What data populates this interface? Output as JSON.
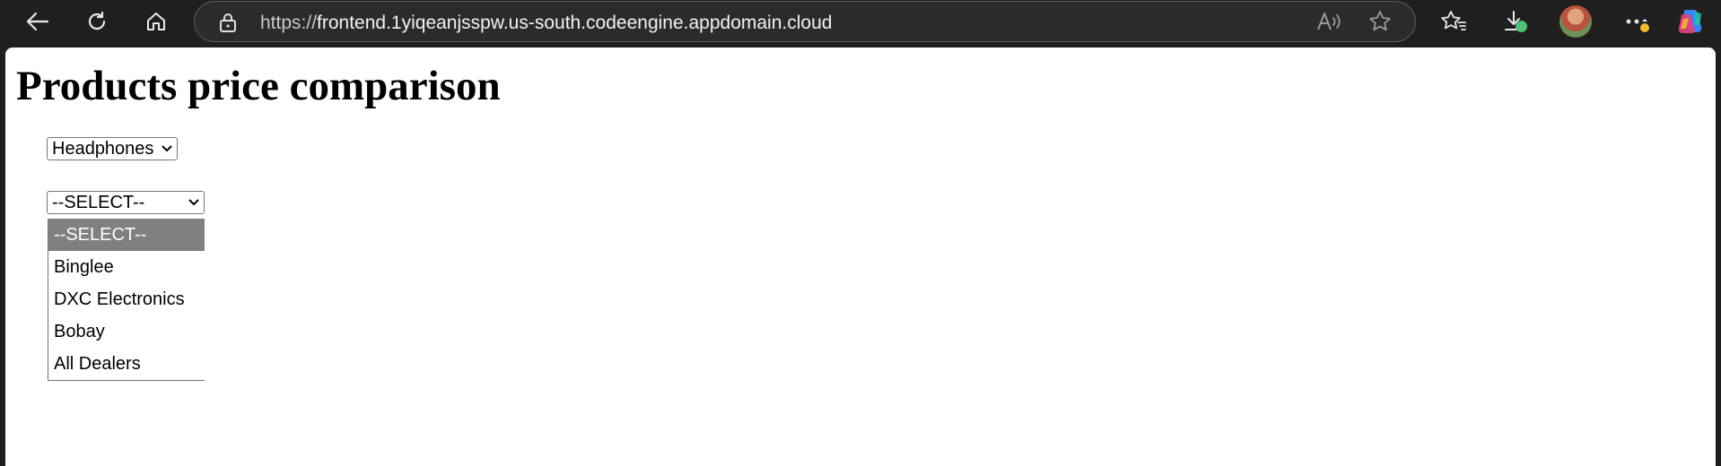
{
  "browser": {
    "url_scheme": "https://",
    "url_host": "frontend.1yiqeanjsspw.us-south.codeengine.appdomain.cloud",
    "icons": [
      "back-icon",
      "refresh-icon",
      "home-icon",
      "lock-icon",
      "read-aloud-icon",
      "favorite-star-icon",
      "favorites-icon",
      "downloads-icon",
      "profile-avatar",
      "more-icon",
      "copilot-icon"
    ]
  },
  "page": {
    "title": "Products price comparison",
    "category_select": {
      "value": "Headphones"
    },
    "dealer_select": {
      "value": "--SELECT--",
      "options": [
        "--SELECT--",
        "Binglee",
        "DXC Electronics",
        "Bobay",
        "All Dealers"
      ],
      "highlighted_index": 0
    }
  },
  "colors": {
    "toolbar_bg": "#1f1f1f",
    "address_bg": "#2b2b2b",
    "option_highlight": "#808080",
    "page_bg": "#ffffff"
  }
}
